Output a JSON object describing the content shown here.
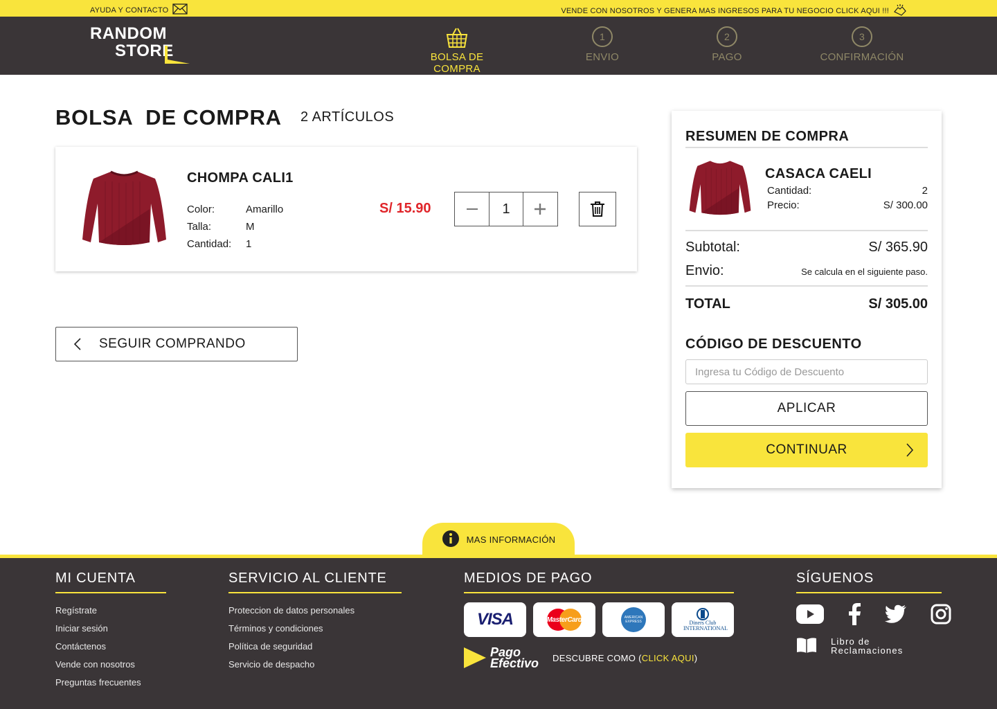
{
  "topbar": {
    "help": "AYUDA Y CONTACTO",
    "promo": "VENDE CON NOSOTROS Y  GENERA MAS INGRESOS PARA TU NEGOCIO CLICK AQUI !!!"
  },
  "header": {
    "logo_line1": "RANDOM",
    "logo_line2": "STORE",
    "steps": [
      {
        "label": "BOLSA DE COMPRA",
        "icon": "basket-icon",
        "active": true
      },
      {
        "number": "1",
        "label": "ENVIO"
      },
      {
        "number": "2",
        "label": "PAGO"
      },
      {
        "number": "3",
        "label": "CONFIRMACIÓN"
      }
    ]
  },
  "cart": {
    "title": "BOLSA  DE COMPRA",
    "count": "2 ARTÍCULOS",
    "item": {
      "name": "CHOMPA CALI1",
      "attrs": [
        {
          "key": "Color:",
          "value": "Amarillo"
        },
        {
          "key": "Talla:",
          "value": "M"
        },
        {
          "key": "Cantidad:",
          "value": "1"
        }
      ],
      "price": "S/ 15.90",
      "qty": "1"
    },
    "back_label": "SEGUIR COMPRANDO"
  },
  "summary": {
    "title": "RESUMEN DE COMPRA",
    "item_name": "CASACA CAELI",
    "qty_label": "Cantidad:",
    "qty_value": "2",
    "price_label": "Precio:",
    "price_value": "S/ 300.00",
    "subtotal_label": "Subtotal:",
    "subtotal_value": "S/  365.90",
    "envio_label": "Envio:",
    "envio_value": "Se calcula en el siguiente paso.",
    "total_label": "TOTAL",
    "total_value": "S/  305.00",
    "discount_title": "CÓDIGO DE DESCUENTO",
    "discount_placeholder": "Ingresa tu Código de Descuento",
    "apply_label": "APLICAR",
    "continue_label": "CONTINUAR"
  },
  "more_info": "MAS INFORMACIÓN",
  "footer": {
    "account": {
      "title": "MI CUENTA",
      "links": [
        "Regístrate",
        "Iniciar sesión",
        "Contáctenos",
        "Vende con nosotros",
        "Preguntas frecuentes"
      ]
    },
    "service": {
      "title": "SERVICIO AL CLIENTE",
      "links": [
        "Proteccion de datos personales",
        "Términos y condiciones",
        "Política de seguridad",
        "Servicio de despacho"
      ]
    },
    "payment": {
      "title": "MEDIOS DE PAGO",
      "cards": [
        "VISA",
        "MasterCard",
        "AMERICAN EXPRESS",
        "Diners Club INTERNATIONAL"
      ],
      "pe_line1": "Pago",
      "pe_line2": "Efectivo",
      "discover": "DESCUBRE COMO (",
      "discover_link": "CLICK AQUI",
      "discover_end": ")"
    },
    "social": {
      "title": "SÍGUENOS",
      "libro_line1": "Libro de",
      "libro_line2": "Reclamaciones"
    }
  },
  "colors": {
    "accent": "#f9e43c",
    "dark": "#3a3537",
    "price": "#e0252a"
  }
}
